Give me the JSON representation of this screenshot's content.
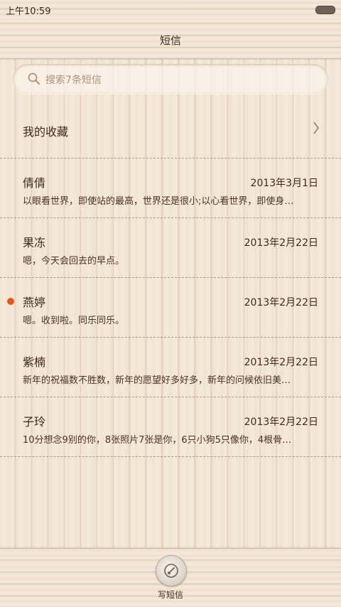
{
  "status_bar": {
    "time": "上午10:59"
  },
  "header": {
    "title": "短信"
  },
  "search": {
    "placeholder": "搜索7条短信"
  },
  "favorites": {
    "label": "我的收藏"
  },
  "messages": [
    {
      "name": "倩倩",
      "date": "2013年3月1日",
      "preview": "以眼看世界，即使站的最高，世界还是很小;以心看世界，即使身…",
      "unread": false
    },
    {
      "name": "果冻",
      "date": "2013年2月22日",
      "preview": "嗯，今天会回去的早点。",
      "unread": false
    },
    {
      "name": "燕婷",
      "date": "2013年2月22日",
      "preview": "嗯。收到啦。同乐同乐。",
      "unread": true
    },
    {
      "name": "紫楠",
      "date": "2013年2月22日",
      "preview": "新年的祝福数不胜数，新年的愿望好多好多，新年的问候依旧美…",
      "unread": false
    },
    {
      "name": "子玲",
      "date": "2013年2月22日",
      "preview": "10分想念9别的你，8张照片7张是你，6只小狗5只像你，4根骨…",
      "unread": false
    }
  ],
  "bottom_bar": {
    "compose_label": "写短信"
  },
  "colors": {
    "unread_dot": "#e8541a",
    "text_primary": "#3f2b18",
    "placeholder": "#a8967f"
  },
  "icons": {
    "search": "search-icon",
    "chevron": "chevron-right-icon",
    "compose": "compose-icon",
    "battery": "battery-icon"
  }
}
